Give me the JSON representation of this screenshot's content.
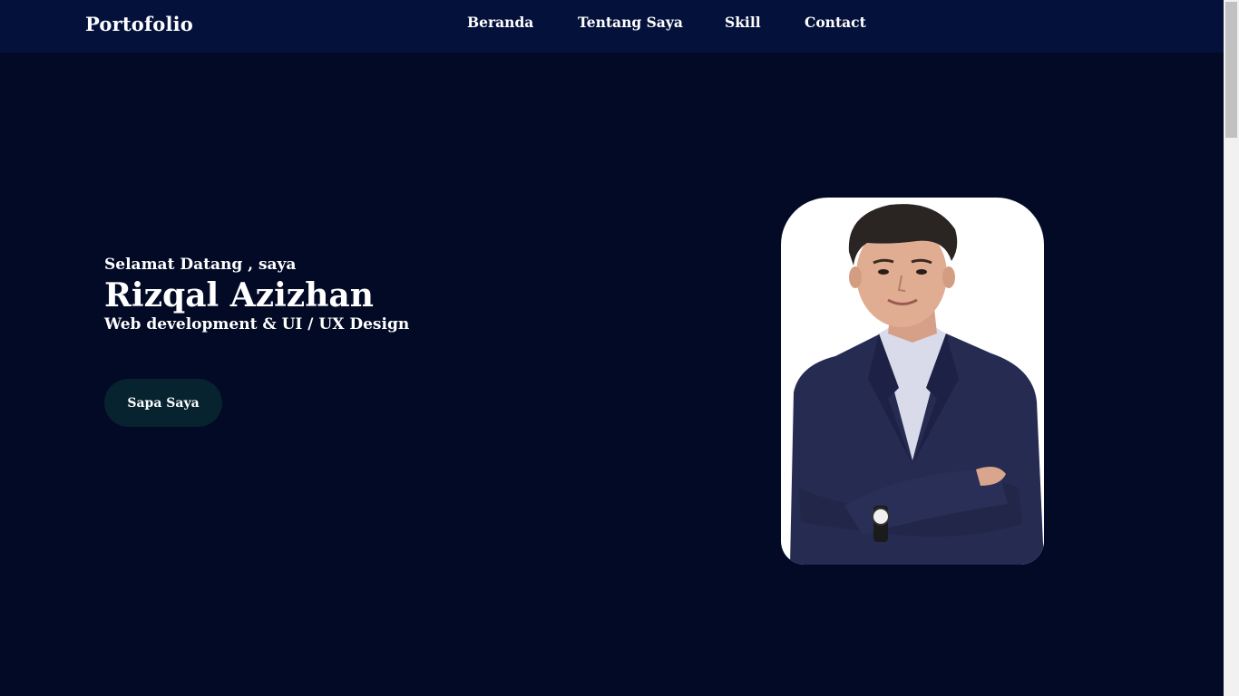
{
  "navbar": {
    "brand": "Portofolio",
    "links": [
      "Beranda",
      "Tentang Saya",
      "Skill",
      "Contact"
    ]
  },
  "hero": {
    "greeting": "Selamat Datang , saya",
    "name": "Rizqal Azizhan",
    "role": "Web development & UI / UX Design",
    "cta_label": "Sapa Saya"
  },
  "colors": {
    "background": "#030a26",
    "navbar": "#03113b",
    "cta": "#06232f",
    "text": "#ffffff"
  },
  "icons": {
    "portrait": "profile-photo"
  }
}
